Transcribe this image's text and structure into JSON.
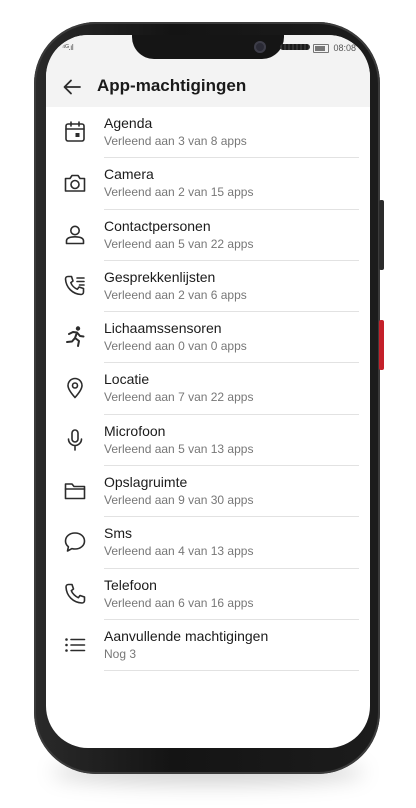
{
  "status_bar": {
    "signal_text": "⁴ᴳ.ıl",
    "time": "08:08"
  },
  "header": {
    "title": "App-machtigingen"
  },
  "permissions": [
    {
      "icon": "calendar-icon",
      "label": "Agenda",
      "detail": "Verleend aan 3 van 8 apps"
    },
    {
      "icon": "camera-icon",
      "label": "Camera",
      "detail": "Verleend aan 2 van 15 apps"
    },
    {
      "icon": "contacts-icon",
      "label": "Contactpersonen",
      "detail": "Verleend aan 5 van 22 apps"
    },
    {
      "icon": "call-log-icon",
      "label": "Gesprekkenlijsten",
      "detail": "Verleend aan 2 van 6 apps"
    },
    {
      "icon": "body-sensors-icon",
      "label": "Lichaamssensoren",
      "detail": "Verleend aan 0 van 0 apps"
    },
    {
      "icon": "location-icon",
      "label": "Locatie",
      "detail": "Verleend aan 7 van 22 apps"
    },
    {
      "icon": "microphone-icon",
      "label": "Microfoon",
      "detail": "Verleend aan 5 van 13 apps"
    },
    {
      "icon": "folder-icon",
      "label": "Opslagruimte",
      "detail": "Verleend aan 9 van 30 apps"
    },
    {
      "icon": "sms-icon",
      "label": "Sms",
      "detail": "Verleend aan 4 van 13 apps"
    },
    {
      "icon": "phone-icon",
      "label": "Telefoon",
      "detail": "Verleend aan 6 van 16 apps"
    },
    {
      "icon": "list-icon",
      "label": "Aanvullende machtigingen",
      "detail": "Nog 3"
    }
  ]
}
